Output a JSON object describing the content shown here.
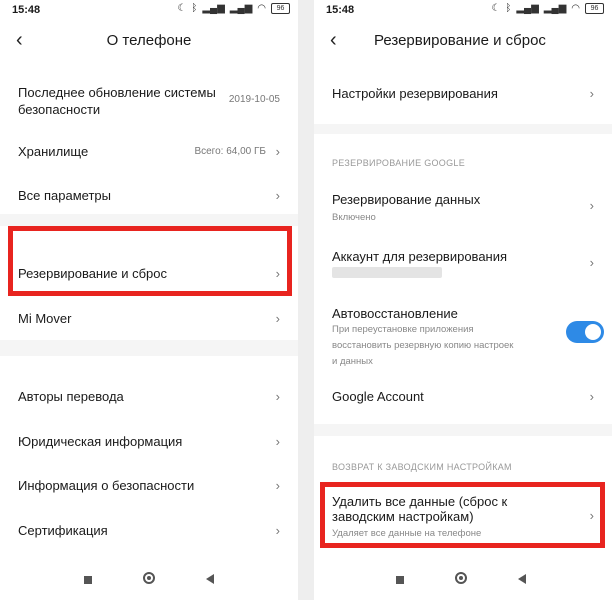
{
  "left": {
    "status": {
      "time": "15:48",
      "battery": "96"
    },
    "title": "О телефоне",
    "items": [
      {
        "label_line1": "Последнее обновление системы",
        "label_line2": "безопасности",
        "value": "2019-10-05"
      },
      {
        "label": "Хранилище",
        "value": "Всего: 64,00 ГБ"
      },
      {
        "label": "Все параметры"
      },
      {
        "label": "Резервирование и сброс"
      },
      {
        "label": "Mi Mover"
      },
      {
        "label": "Авторы перевода"
      },
      {
        "label": "Юридическая информация"
      },
      {
        "label": "Информация о безопасности"
      },
      {
        "label": "Сертификация"
      }
    ]
  },
  "right": {
    "status": {
      "time": "15:48",
      "battery": "96"
    },
    "title": "Резервирование и сброс",
    "backup_settings": "Настройки резервирования",
    "section_google": "РЕЗЕРВИРОВАНИЕ GOOGLE",
    "data_backup": {
      "label": "Резервирование данных",
      "sub": "Включено"
    },
    "backup_account": {
      "label": "Аккаунт для резервирования"
    },
    "auto_restore": {
      "label": "Автовосстановление",
      "sub1": "При переустановке приложения",
      "sub2": "восстановить резервную копию настроек",
      "sub3": "и данных",
      "enabled": true
    },
    "google_account": "Google Account",
    "section_factory": "ВОЗВРАТ К ЗАВОДСКИМ НАСТРОЙКАМ",
    "factory_reset": {
      "line1": "Удалить все данные (сброс к",
      "line2": "заводским настройкам)",
      "sub": "Удаляет все данные на телефоне"
    }
  },
  "chevron": "›",
  "back": "‹",
  "colors": {
    "highlight": "#e8241f",
    "toggle": "#2e8ae6"
  }
}
